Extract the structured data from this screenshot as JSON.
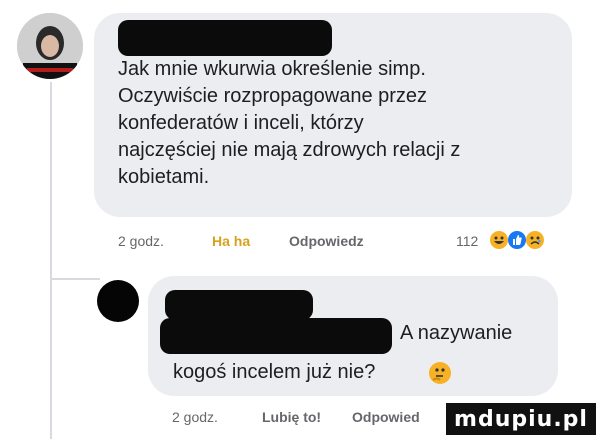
{
  "comment1": {
    "text": "Jak mnie wkurwia określenie simp. Oczywiście rozpropagowane przez konfederatów i inceli, którzy najczęściej nie mają zdrowych relacji z kobietami.",
    "lines": [
      "Jak mnie wkurwia określenie simp.",
      "Oczywiście rozpropagowane przez",
      "konfederatów i inceli, którzy",
      "najczęściej nie mają zdrowych relacji z",
      "kobietami."
    ],
    "time": "2 godz.",
    "reaction_label": "Ha ha",
    "reply_label": "Odpowiedz",
    "reaction_count": "112",
    "reactions": [
      "laugh-emoji",
      "like-icon",
      "sad-emoji"
    ]
  },
  "comment2": {
    "line1": "A nazywanie",
    "line2": "kogoś incelem już nie?",
    "emoji": "thinking-emoji",
    "time": "2 godz.",
    "like_label": "Lubię to!",
    "reply_label": "Odpowied"
  },
  "watermark": "mdupiu.pl",
  "colors": {
    "bubble": "#ecedf0",
    "meta_text": "#65676b",
    "like_blue": "#1877f2",
    "haha_yellow": "#f7b125"
  }
}
